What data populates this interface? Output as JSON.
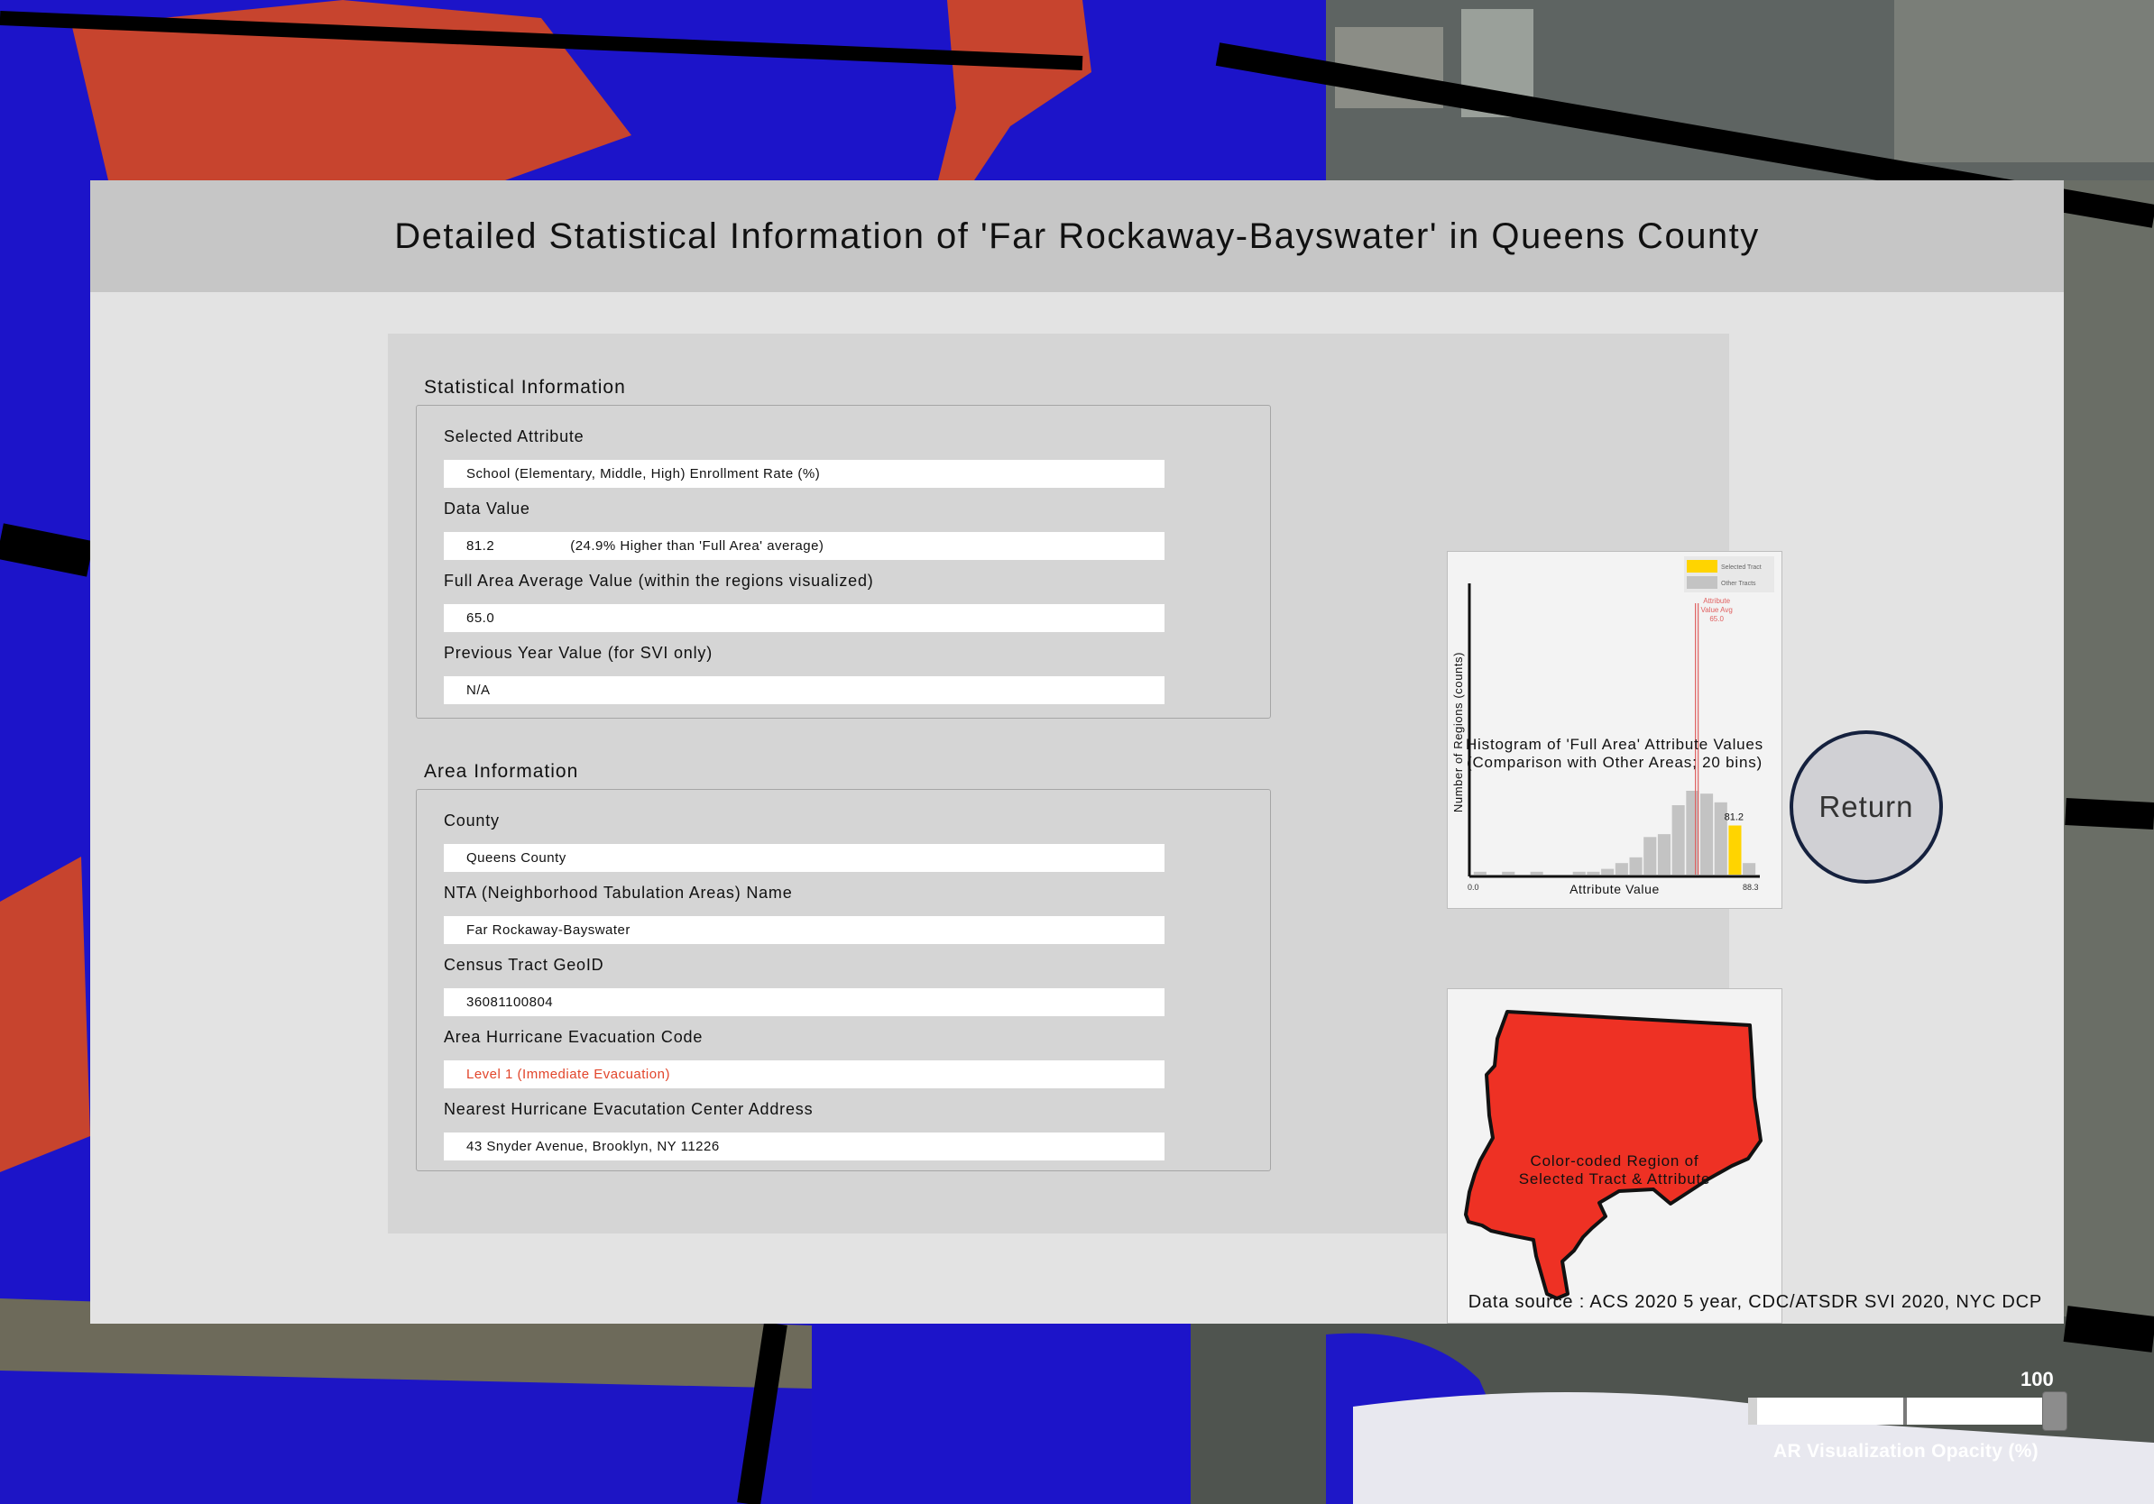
{
  "header": {
    "title": "Detailed Statistical Information of 'Far Rockaway-Bayswater' in Queens County"
  },
  "statistical_info": {
    "section_title": "Statistical Information",
    "fields": [
      {
        "label": "Selected Attribute",
        "value": "School (Elementary, Middle, High) Enrollment Rate (%)"
      },
      {
        "label": "Data Value",
        "value": "81.2",
        "note": "(24.9% Higher than 'Full Area' average)"
      },
      {
        "label": "Full Area Average Value (within the regions visualized)",
        "value": "65.0"
      },
      {
        "label": "Previous Year Value (for SVI only)",
        "value": "N/A"
      }
    ]
  },
  "area_info": {
    "section_title": "Area Information",
    "fields": [
      {
        "label": "County",
        "value": "Queens County"
      },
      {
        "label": "NTA (Neighborhood Tabulation Areas) Name",
        "value": "Far Rockaway-Bayswater"
      },
      {
        "label": "Census Tract GeoID",
        "value": "36081100804"
      },
      {
        "label": "Area Hurricane Evacuation Code",
        "value": "Level 1 (Immediate Evacuation)"
      },
      {
        "label": "Nearest Hurricane Evacutation Center Address",
        "value": "43 Snyder Avenue, Brooklyn, NY 11226"
      }
    ]
  },
  "histogram": {
    "caption_line1": "Histogram of 'Full Area' Attribute Values",
    "caption_line2": "(Comparison with Other Areas; 20 bins)"
  },
  "chart_data": {
    "type": "bar",
    "xlabel": "Attribute Value",
    "ylabel": "Number of Regions (counts)",
    "x_min_label": "0.0",
    "x_max_label": "88.3",
    "xlim": [
      0.0,
      88.3
    ],
    "bins": 20,
    "counts": [
      1,
      0,
      1,
      0,
      1,
      0,
      0,
      1,
      1,
      2,
      4,
      6,
      13,
      14,
      24,
      29,
      28,
      25,
      17,
      4
    ],
    "selected_bin": 18,
    "selected_value_label": "81.2",
    "average_value": 65.0,
    "average_annotation": [
      "Attribute",
      "Value Avg",
      "65.0"
    ],
    "legend": [
      {
        "name": "Selected Tract",
        "color": "#ffd400"
      },
      {
        "name": "Other Tracts",
        "color": "#c3c3c3"
      }
    ],
    "legend_position": "top-right",
    "bar_color": "#c3c3c3",
    "selected_color": "#ffd400",
    "avg_line_color": "#e06060"
  },
  "map": {
    "caption_line1": "Color-coded Region of",
    "caption_line2": "Selected Tract & Attribute",
    "fill_color": "#ee3124"
  },
  "footer": {
    "data_source": "Data source : ACS 2020 5 year, CDC/ATSDR SVI 2020, NYC DCP"
  },
  "return_button": {
    "label": "Return"
  },
  "opacity_slider": {
    "max_label": "100",
    "label": "AR Visualization Opacity (%)",
    "value": 100
  }
}
